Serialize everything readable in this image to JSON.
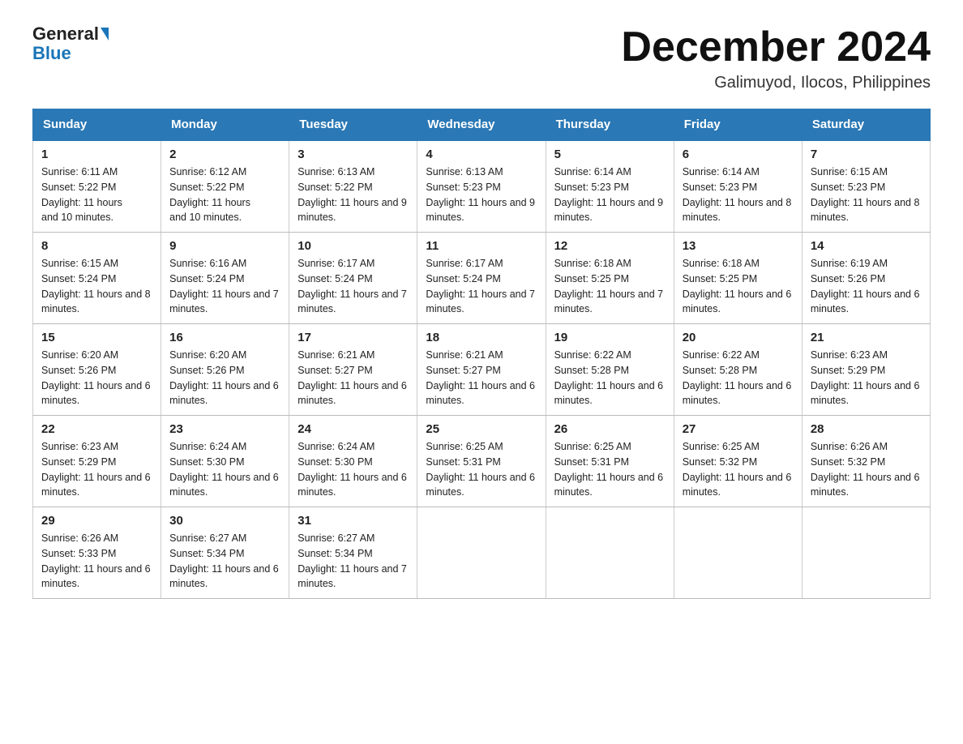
{
  "header": {
    "logo_general": "General",
    "logo_blue": "Blue",
    "month_year": "December 2024",
    "location": "Galimuyod, Ilocos, Philippines"
  },
  "weekdays": [
    "Sunday",
    "Monday",
    "Tuesday",
    "Wednesday",
    "Thursday",
    "Friday",
    "Saturday"
  ],
  "weeks": [
    [
      {
        "day": "1",
        "sunrise": "6:11 AM",
        "sunset": "5:22 PM",
        "daylight": "11 hours and 10 minutes."
      },
      {
        "day": "2",
        "sunrise": "6:12 AM",
        "sunset": "5:22 PM",
        "daylight": "11 hours and 10 minutes."
      },
      {
        "day": "3",
        "sunrise": "6:13 AM",
        "sunset": "5:22 PM",
        "daylight": "11 hours and 9 minutes."
      },
      {
        "day": "4",
        "sunrise": "6:13 AM",
        "sunset": "5:23 PM",
        "daylight": "11 hours and 9 minutes."
      },
      {
        "day": "5",
        "sunrise": "6:14 AM",
        "sunset": "5:23 PM",
        "daylight": "11 hours and 9 minutes."
      },
      {
        "day": "6",
        "sunrise": "6:14 AM",
        "sunset": "5:23 PM",
        "daylight": "11 hours and 8 minutes."
      },
      {
        "day": "7",
        "sunrise": "6:15 AM",
        "sunset": "5:23 PM",
        "daylight": "11 hours and 8 minutes."
      }
    ],
    [
      {
        "day": "8",
        "sunrise": "6:15 AM",
        "sunset": "5:24 PM",
        "daylight": "11 hours and 8 minutes."
      },
      {
        "day": "9",
        "sunrise": "6:16 AM",
        "sunset": "5:24 PM",
        "daylight": "11 hours and 7 minutes."
      },
      {
        "day": "10",
        "sunrise": "6:17 AM",
        "sunset": "5:24 PM",
        "daylight": "11 hours and 7 minutes."
      },
      {
        "day": "11",
        "sunrise": "6:17 AM",
        "sunset": "5:24 PM",
        "daylight": "11 hours and 7 minutes."
      },
      {
        "day": "12",
        "sunrise": "6:18 AM",
        "sunset": "5:25 PM",
        "daylight": "11 hours and 7 minutes."
      },
      {
        "day": "13",
        "sunrise": "6:18 AM",
        "sunset": "5:25 PM",
        "daylight": "11 hours and 6 minutes."
      },
      {
        "day": "14",
        "sunrise": "6:19 AM",
        "sunset": "5:26 PM",
        "daylight": "11 hours and 6 minutes."
      }
    ],
    [
      {
        "day": "15",
        "sunrise": "6:20 AM",
        "sunset": "5:26 PM",
        "daylight": "11 hours and 6 minutes."
      },
      {
        "day": "16",
        "sunrise": "6:20 AM",
        "sunset": "5:26 PM",
        "daylight": "11 hours and 6 minutes."
      },
      {
        "day": "17",
        "sunrise": "6:21 AM",
        "sunset": "5:27 PM",
        "daylight": "11 hours and 6 minutes."
      },
      {
        "day": "18",
        "sunrise": "6:21 AM",
        "sunset": "5:27 PM",
        "daylight": "11 hours and 6 minutes."
      },
      {
        "day": "19",
        "sunrise": "6:22 AM",
        "sunset": "5:28 PM",
        "daylight": "11 hours and 6 minutes."
      },
      {
        "day": "20",
        "sunrise": "6:22 AM",
        "sunset": "5:28 PM",
        "daylight": "11 hours and 6 minutes."
      },
      {
        "day": "21",
        "sunrise": "6:23 AM",
        "sunset": "5:29 PM",
        "daylight": "11 hours and 6 minutes."
      }
    ],
    [
      {
        "day": "22",
        "sunrise": "6:23 AM",
        "sunset": "5:29 PM",
        "daylight": "11 hours and 6 minutes."
      },
      {
        "day": "23",
        "sunrise": "6:24 AM",
        "sunset": "5:30 PM",
        "daylight": "11 hours and 6 minutes."
      },
      {
        "day": "24",
        "sunrise": "6:24 AM",
        "sunset": "5:30 PM",
        "daylight": "11 hours and 6 minutes."
      },
      {
        "day": "25",
        "sunrise": "6:25 AM",
        "sunset": "5:31 PM",
        "daylight": "11 hours and 6 minutes."
      },
      {
        "day": "26",
        "sunrise": "6:25 AM",
        "sunset": "5:31 PM",
        "daylight": "11 hours and 6 minutes."
      },
      {
        "day": "27",
        "sunrise": "6:25 AM",
        "sunset": "5:32 PM",
        "daylight": "11 hours and 6 minutes."
      },
      {
        "day": "28",
        "sunrise": "6:26 AM",
        "sunset": "5:32 PM",
        "daylight": "11 hours and 6 minutes."
      }
    ],
    [
      {
        "day": "29",
        "sunrise": "6:26 AM",
        "sunset": "5:33 PM",
        "daylight": "11 hours and 6 minutes."
      },
      {
        "day": "30",
        "sunrise": "6:27 AM",
        "sunset": "5:34 PM",
        "daylight": "11 hours and 6 minutes."
      },
      {
        "day": "31",
        "sunrise": "6:27 AM",
        "sunset": "5:34 PM",
        "daylight": "11 hours and 7 minutes."
      },
      null,
      null,
      null,
      null
    ]
  ]
}
